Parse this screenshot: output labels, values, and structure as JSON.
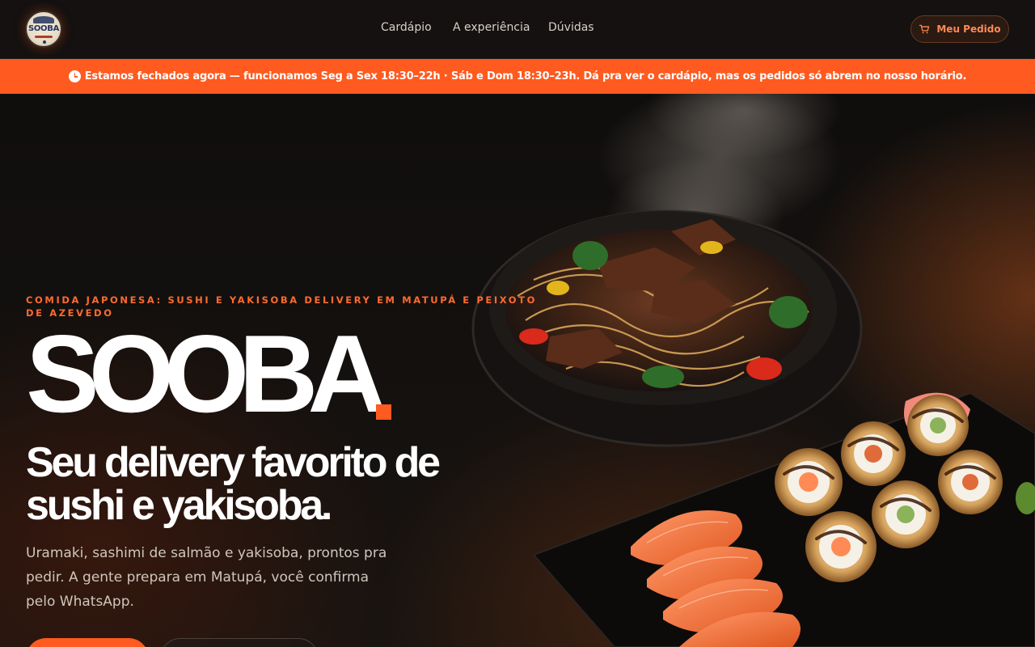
{
  "header": {
    "logo_text": "SOOBA",
    "nav": [
      {
        "label": "Cardápio"
      },
      {
        "label": "A experiência"
      },
      {
        "label": "Dúvidas"
      }
    ],
    "order_button": "Meu Pedido"
  },
  "banner": {
    "text": "Estamos fechados agora — funcionamos Seg a Sex 18:30–22h · Sáb e Dom 18:30–23h. Dá pra ver o cardápio, mas os pedidos só abrem no nosso horário."
  },
  "hero": {
    "eyebrow": "Comida japonesa: sushi e yakisoba delivery em Matupá e Peixoto de Azevedo",
    "brand": "SOOBA",
    "tagline": "Seu delivery favorito de sushi e yakisoba.",
    "description": "Uramaki, sashimi de salmão e yakisoba, prontos pra pedir. A gente prepara em Matupá, você confirma pelo WhatsApp."
  },
  "colors": {
    "accent": "#ff5a1f",
    "background": "#0c0a09",
    "header": "#141110"
  },
  "icons": {
    "logo": "sooba-logo",
    "cart": "cart-icon",
    "clock": "clock-icon"
  }
}
